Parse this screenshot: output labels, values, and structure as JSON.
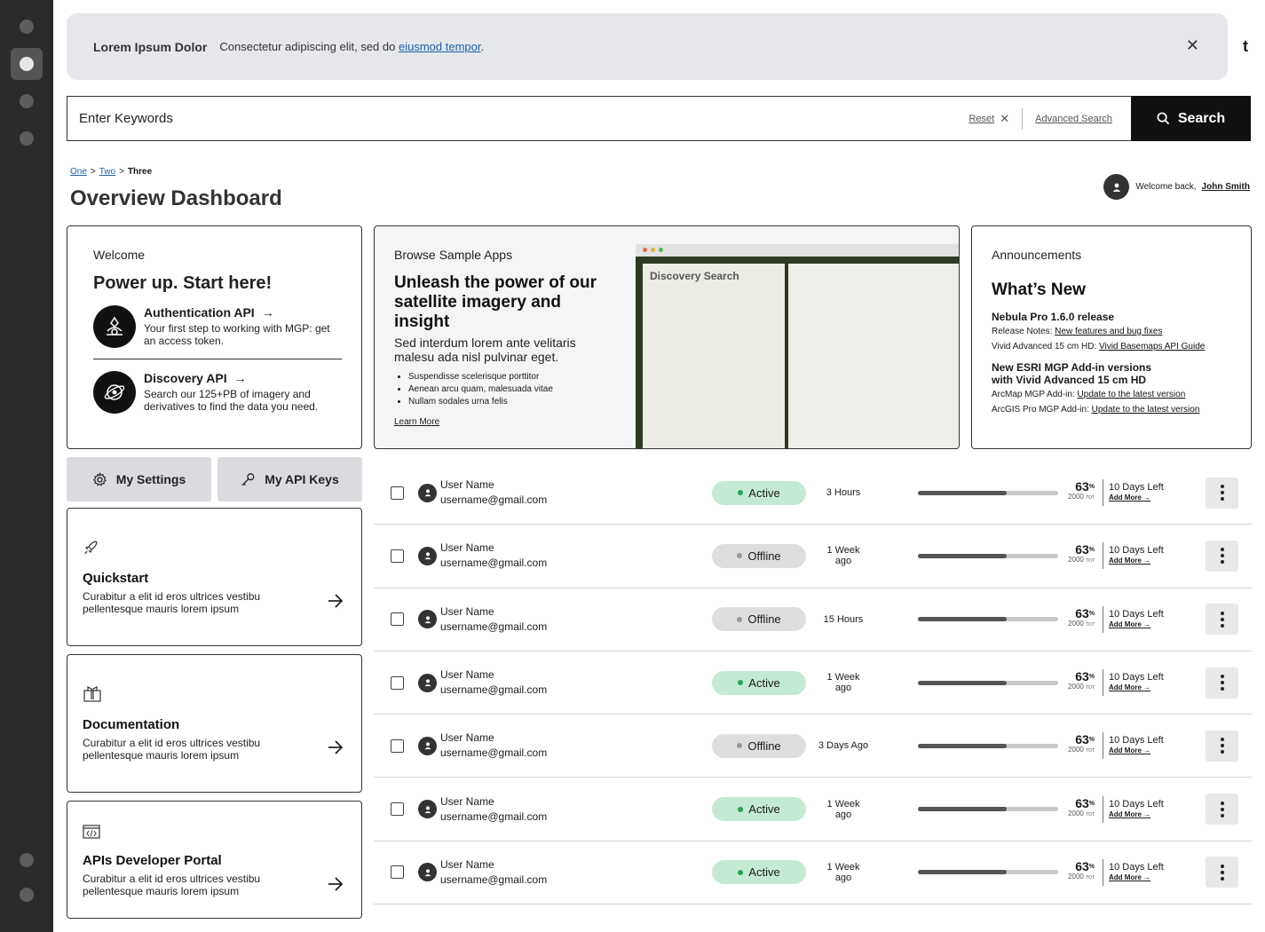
{
  "banner": {
    "title": "Lorem Ipsum Dolor",
    "text": "Consectetur adipiscing elit, sed do",
    "link": "eiusmod tempor",
    "period": ".",
    "close": "✕"
  },
  "edge_text": "t",
  "search": {
    "placeholder": "Enter Keywords",
    "reset": "Reset",
    "advanced": "Advanced Search",
    "button": "Search"
  },
  "breadcrumb": {
    "one": "One",
    "two": "Two",
    "three": "Three",
    "sep": ">"
  },
  "page_title": "Overview Dashboard",
  "user": {
    "greeting": "Welcome back,",
    "name": "John Smith"
  },
  "welcome_card": {
    "label": "Welcome",
    "heading": "Power up. Start here!",
    "items": [
      {
        "title": "Authentication API",
        "desc": "Your first step to working with MGP: get an access token."
      },
      {
        "title": "Discovery API",
        "desc": "Search our 125+PB of imagery and derivatives to find the data you need."
      }
    ]
  },
  "browse_card": {
    "label": "Browse Sample Apps",
    "heading": "Unleash the power of our satellite imagery and insight",
    "sub": "Sed interdum lorem ante velitaris malesu ada nisl pulvinar eget.",
    "bullets": [
      "Suspendisse scelerisque porttitor",
      "Aenean arcu quam, malesuada vitae",
      "Nullam sodales urna felis"
    ],
    "learn_more": "Learn More",
    "preview_title": "Discovery Search"
  },
  "announcements": {
    "label": "Announcements",
    "heading": "What’s New",
    "release_title": "Nebula Pro 1.6.0 release",
    "release_notes_label": "Release Notes:",
    "release_notes_link": "New features and bug fixes",
    "vivid_label": "Vivid Advanced 15 cm HD:",
    "vivid_link": "Vivid Basemaps API Guide",
    "esri_title": "New ESRI MGP Add-in versions with Vivid Advanced 15 cm HD",
    "arcmap_label": "ArcMap MGP Add-in:",
    "arcmap_link": "Update to the latest version",
    "arcgis_label": "ArcGIS Pro MGP Add-in:",
    "arcgis_link": "Update to the latest version"
  },
  "buttons": {
    "settings": "My Settings",
    "keys": "My API Keys"
  },
  "tiles": [
    {
      "title": "Quickstart",
      "desc": "Curabitur a elit id eros ultrices vestibu pellentesque mauris lorem ipsum",
      "icon": "rocket-icon"
    },
    {
      "title": "Documentation",
      "desc": "Curabitur a elit id eros ultrices vestibu pellentesque mauris lorem ipsum",
      "icon": "book-icon"
    },
    {
      "title": "APIs Developer Portal",
      "desc": "Curabitur a elit id eros ultrices vestibu pellentesque mauris lorem ipsum",
      "icon": "code-window-icon"
    }
  ],
  "rows": [
    {
      "name": "User Name",
      "email": "username@gmail.com",
      "status": "Active",
      "time": "3 Hours",
      "progress": 0.63,
      "pct": "63",
      "pct_unit": "%",
      "total": "2000",
      "total_unit": "TOT",
      "days": "10 Days Left",
      "add_more": "Add More"
    },
    {
      "name": "User Name",
      "email": "username@gmail.com",
      "status": "Offline",
      "time": "1 Week ago",
      "progress": 0.63,
      "pct": "63",
      "pct_unit": "%",
      "total": "2000",
      "total_unit": "TOT",
      "days": "10 Days Left",
      "add_more": "Add More"
    },
    {
      "name": "User Name",
      "email": "username@gmail.com",
      "status": "Offline",
      "time": "15 Hours",
      "progress": 0.63,
      "pct": "63",
      "pct_unit": "%",
      "total": "2000",
      "total_unit": "TOT",
      "days": "10 Days Left",
      "add_more": "Add More"
    },
    {
      "name": "User Name",
      "email": "username@gmail.com",
      "status": "Active",
      "time": "1 Week ago",
      "progress": 0.63,
      "pct": "63",
      "pct_unit": "%",
      "total": "2000",
      "total_unit": "TOT",
      "days": "10 Days Left",
      "add_more": "Add More"
    },
    {
      "name": "User Name",
      "email": "username@gmail.com",
      "status": "Offline",
      "time": "3 Days Ago",
      "progress": 0.63,
      "pct": "63",
      "pct_unit": "%",
      "total": "2000",
      "total_unit": "TOT",
      "days": "10 Days Left",
      "add_more": "Add More"
    },
    {
      "name": "User Name",
      "email": "username@gmail.com",
      "status": "Active",
      "time": "1 Week ago",
      "progress": 0.63,
      "pct": "63",
      "pct_unit": "%",
      "total": "2000",
      "total_unit": "TOT",
      "days": "10 Days Left",
      "add_more": "Add More"
    },
    {
      "name": "User Name",
      "email": "username@gmail.com",
      "status": "Active",
      "time": "1 Week ago",
      "progress": 0.63,
      "pct": "63",
      "pct_unit": "%",
      "total": "2000",
      "total_unit": "TOT",
      "days": "10 Days Left",
      "add_more": "Add More"
    }
  ],
  "colors": {
    "active_bg": "#c5ead3",
    "active_dot": "#2aa35a",
    "offline_bg": "#dedede",
    "offline_dot": "#999999",
    "rail": "#2b2b2b",
    "banner": "#e5e7eb"
  }
}
